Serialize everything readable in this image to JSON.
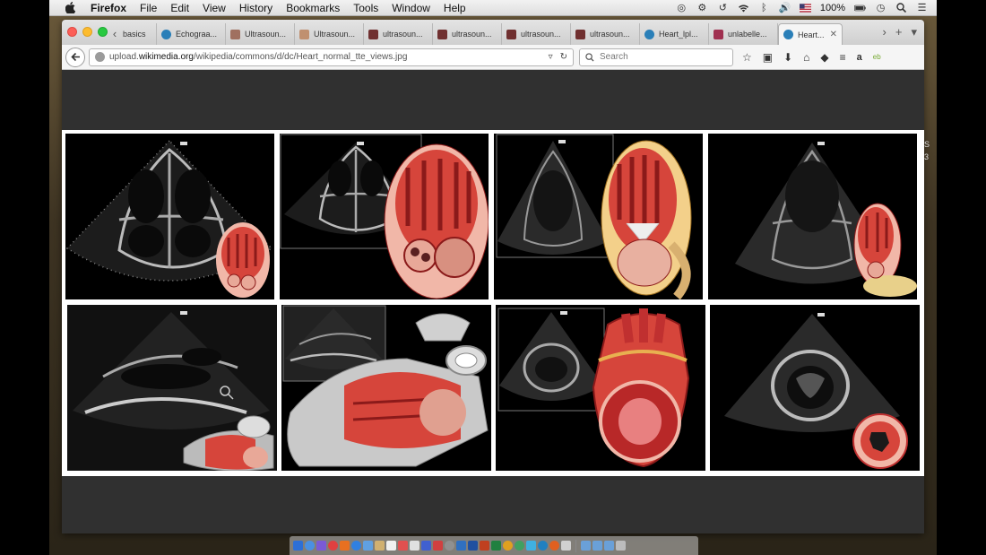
{
  "menubar": {
    "app": "Firefox",
    "items": [
      "File",
      "Edit",
      "View",
      "History",
      "Bookmarks",
      "Tools",
      "Window",
      "Help"
    ],
    "battery": "100%"
  },
  "tabs": [
    {
      "label": "basics",
      "color": "#d0d0d0"
    },
    {
      "label": "Echograa...",
      "color": "#2a7fb8"
    },
    {
      "label": "Ultrasoun...",
      "color": "#a07060"
    },
    {
      "label": "Ultrasoun...",
      "color": "#c09070"
    },
    {
      "label": "ultrasoun...",
      "color": "#703030"
    },
    {
      "label": "ultrasoun...",
      "color": "#703030"
    },
    {
      "label": "ultrasoun...",
      "color": "#703030"
    },
    {
      "label": "ultrasoun...",
      "color": "#703030"
    },
    {
      "label": "Heart_lpl...",
      "color": "#2a7fb8"
    },
    {
      "label": "unlabelle...",
      "color": "#a03050"
    },
    {
      "label": "Heart...",
      "color": "#2a7fb8",
      "active": true
    }
  ],
  "nav": {
    "url_prefix": "upload.",
    "url_host": "wikimedia.org",
    "url_path": "/wikipedia/commons/d/dc/Heart_normal_tte_views.jpg",
    "search_placeholder": "Search"
  },
  "colors": {
    "heart_red": "#d6453b",
    "heart_light": "#f1b7a8",
    "muscle_dark": "#8b1a1a"
  }
}
